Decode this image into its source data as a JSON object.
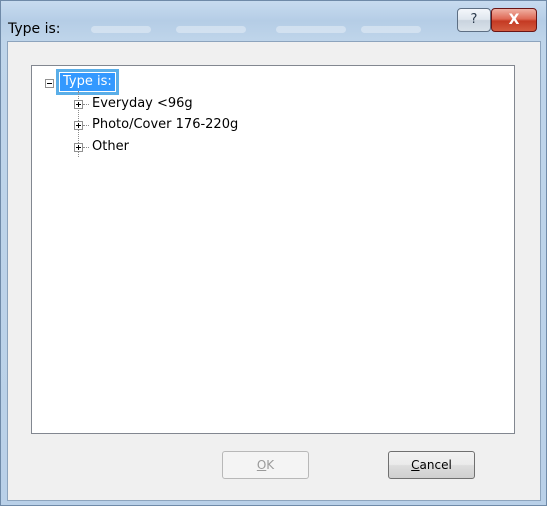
{
  "window": {
    "title": "Type is:",
    "help_glyph": "?",
    "close_glyph": "X"
  },
  "tree": {
    "root": {
      "label": "Type is:",
      "expanded": true,
      "selected": true
    },
    "children": [
      {
        "label": "Everyday <96g",
        "expanded": false
      },
      {
        "label": "Photo/Cover 176-220g",
        "expanded": false
      },
      {
        "label": "Other",
        "expanded": false
      }
    ]
  },
  "buttons": {
    "ok": {
      "label": "OK",
      "mnemonic": "O",
      "enabled": false
    },
    "cancel": {
      "label": "Cancel",
      "mnemonic": "C",
      "enabled": true
    }
  },
  "colors": {
    "selection": "#3399ff",
    "close_button": "#c43a23"
  },
  "icons": {
    "collapse": "minus-box-icon",
    "expand": "plus-box-icon",
    "help": "question-mark-icon",
    "close": "close-x-icon"
  }
}
